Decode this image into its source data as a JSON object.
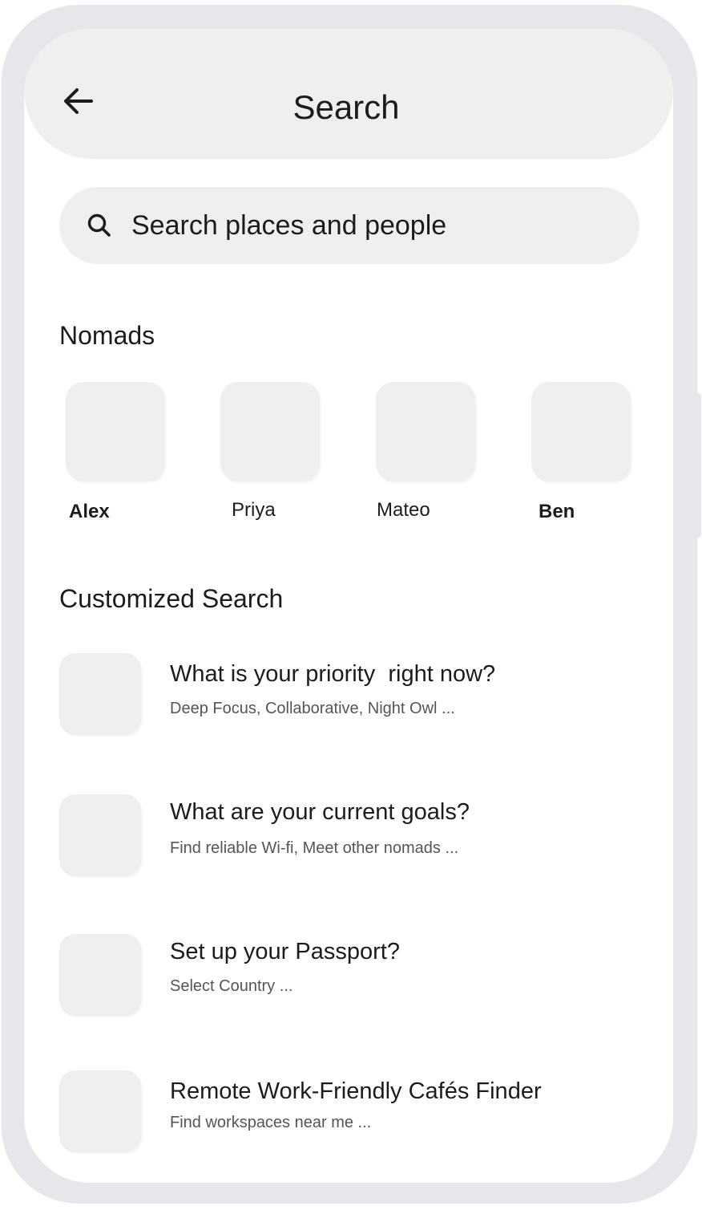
{
  "header": {
    "title": "Search",
    "back_icon": "arrow-left-icon"
  },
  "search": {
    "placeholder": "Search places and people",
    "icon": "search-icon"
  },
  "nomads": {
    "title": "Nomads",
    "people": [
      {
        "name": "Alex"
      },
      {
        "name": "Priya"
      },
      {
        "name": "Mateo"
      },
      {
        "name": "Ben"
      }
    ]
  },
  "customized": {
    "title": "Customized Search",
    "items": [
      {
        "title": "What is your priority  right now?",
        "subtitle": "Deep Focus, Collaborative, Night Owl ..."
      },
      {
        "title": "What are your current goals?",
        "subtitle": "Find reliable Wi-fi, Meet other nomads ..."
      },
      {
        "title": "Set up your Passport?",
        "subtitle": "Select Country ..."
      },
      {
        "title": "Remote Work-Friendly Cafés Finder",
        "subtitle": "Find workspaces near me ..."
      }
    ]
  },
  "colors": {
    "frame": "#e6e7eb",
    "surface": "#efefef",
    "text": "#1c1c1c",
    "muted": "#555555"
  }
}
